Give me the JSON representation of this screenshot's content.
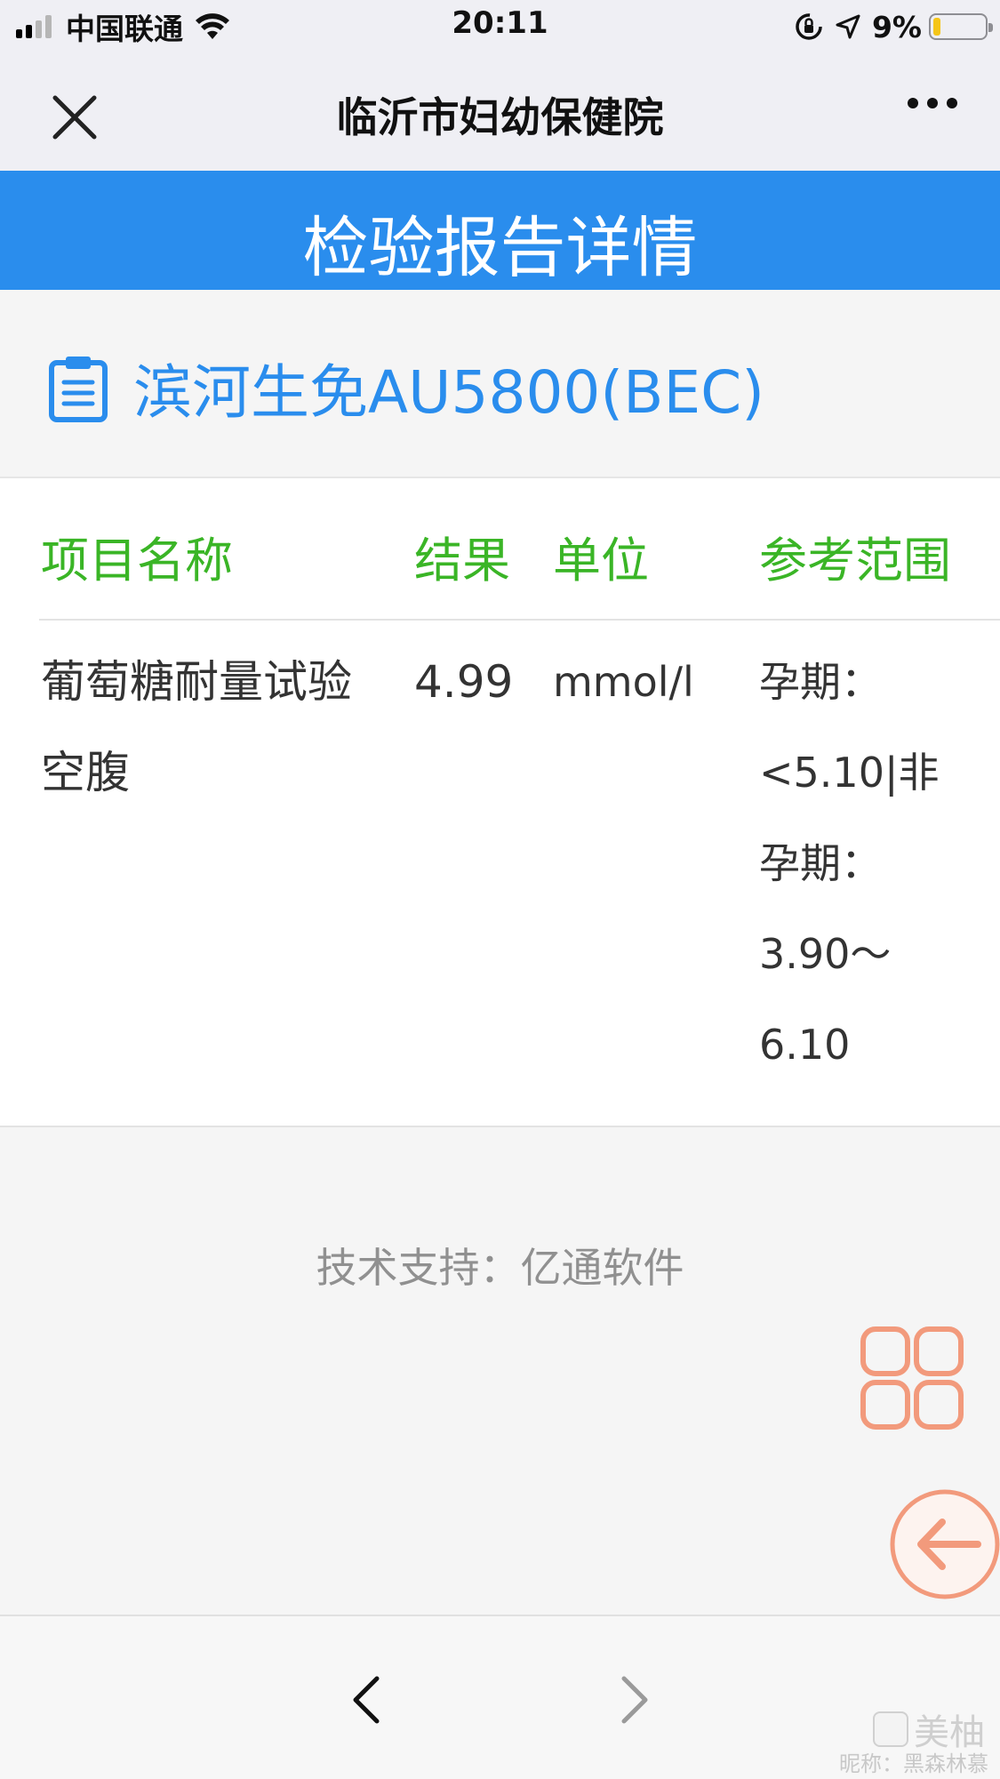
{
  "status_bar": {
    "carrier": "中国联通",
    "time": "20:11",
    "battery": "9%",
    "signal_bars": 4,
    "signal_bars_filled": 2,
    "battery_level": 0.09,
    "colors": {
      "battery_fill": "#f5c518"
    }
  },
  "nav": {
    "title": "临沂市妇幼保健院",
    "close_icon": "close-icon",
    "more_icon": "more-icon"
  },
  "header": {
    "title": "检验报告详情",
    "color": "#2a8ded"
  },
  "device": {
    "icon": "clipboard-icon",
    "name": "滨河生免AU5800(BEC)"
  },
  "table": {
    "columns": {
      "name": "项目名称",
      "result": "结果",
      "unit": "单位",
      "range": "参考范围"
    },
    "header_color": "#3ab526",
    "rows": [
      {
        "name_lines": [
          "葡萄糖耐量试验",
          "空腹"
        ],
        "result": "4.99",
        "unit": "mmol/l",
        "range_lines": [
          "孕期：",
          "<5.10|非",
          "孕期：",
          "3.90～",
          "6.10"
        ]
      }
    ]
  },
  "footer": {
    "support": "技术支持：亿通软件",
    "grid_icon": "grid-menu-icon",
    "back_icon": "back-arrow-icon",
    "accent": "#f29a7c"
  },
  "bottom_bar": {
    "back_icon": "chevron-left-icon",
    "forward_icon": "chevron-right-icon"
  },
  "watermark": {
    "logo_text": "美柚",
    "nickname": "昵称：黑森林慕斯"
  }
}
